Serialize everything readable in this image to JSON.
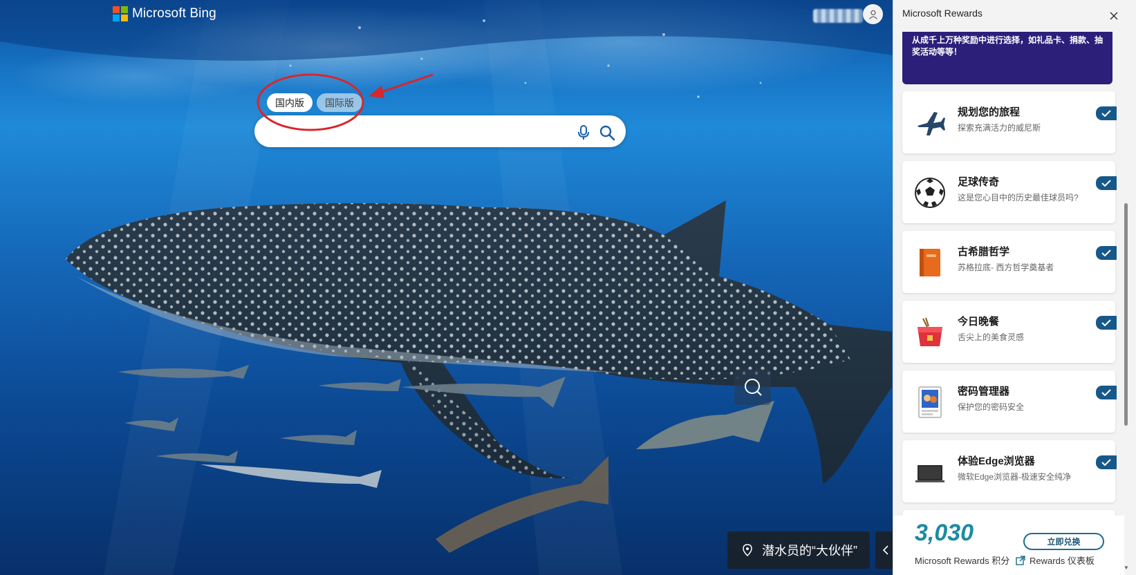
{
  "brand": {
    "name": "Microsoft Bing"
  },
  "version_toggle": {
    "domestic": "国内版",
    "international": "国际版"
  },
  "search": {
    "placeholder": ""
  },
  "caption": {
    "text": "潜水员的“大伙伴”"
  },
  "rewards": {
    "title": "Microsoft Rewards",
    "promo_text": "从成千上万种奖励中进行选择，如礼品卡、捐款、抽奖活动等等！",
    "cards": [
      {
        "title": "规划您的旅程",
        "desc": "探索充满活力的威尼斯",
        "icon": "airplane-icon"
      },
      {
        "title": "足球传奇",
        "desc": "这是您心目中的历史最佳球员吗?",
        "icon": "soccer-ball-icon"
      },
      {
        "title": "古希腊哲学",
        "desc": "苏格拉底- 西方哲学奠基者",
        "icon": "book-icon"
      },
      {
        "title": "今日晚餐",
        "desc": "舌尖上的美食灵感",
        "icon": "takeout-box-icon"
      },
      {
        "title": "密码管理器",
        "desc": "保护您的密码安全",
        "icon": "id-card-icon"
      },
      {
        "title": "体验Edge浏览器",
        "desc": "微软Edge浏览器-极速安全纯净",
        "icon": "laptop-icon"
      }
    ],
    "points": "3,030",
    "points_label": "Microsoft Rewards 积分",
    "redeem_label": "立即兑换",
    "dashboard_label": "Rewards 仪表板"
  },
  "colors": {
    "accent": "#17588a",
    "points": "#1c8ba0",
    "promo_bg": "#2b1f7a",
    "annotation": "#d8262b"
  }
}
